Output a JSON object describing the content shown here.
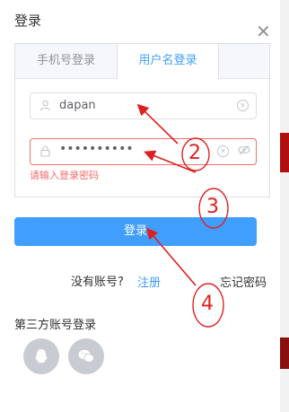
{
  "dialog": {
    "title": "登录",
    "close_icon": "close-icon"
  },
  "tabs": [
    {
      "label": "手机号登录",
      "active": false
    },
    {
      "label": "用户名登录",
      "active": true
    }
  ],
  "username": {
    "value": "dapan",
    "icon": "user-icon"
  },
  "password": {
    "value": "••••••••••",
    "icon": "lock-icon",
    "error": "请输入登录密码"
  },
  "login_button": {
    "label": "登录"
  },
  "register": {
    "prompt": "没有账号?",
    "link": "注册"
  },
  "forgot_password": "忘记密码",
  "third_party": {
    "label": "第三方账号登录",
    "icons": [
      "qq-icon",
      "wechat-icon"
    ]
  },
  "annotations": [
    "2",
    "3",
    "4"
  ],
  "colors": {
    "primary": "#409eff",
    "error": "#f56c6c",
    "annotation": "#e02020"
  }
}
